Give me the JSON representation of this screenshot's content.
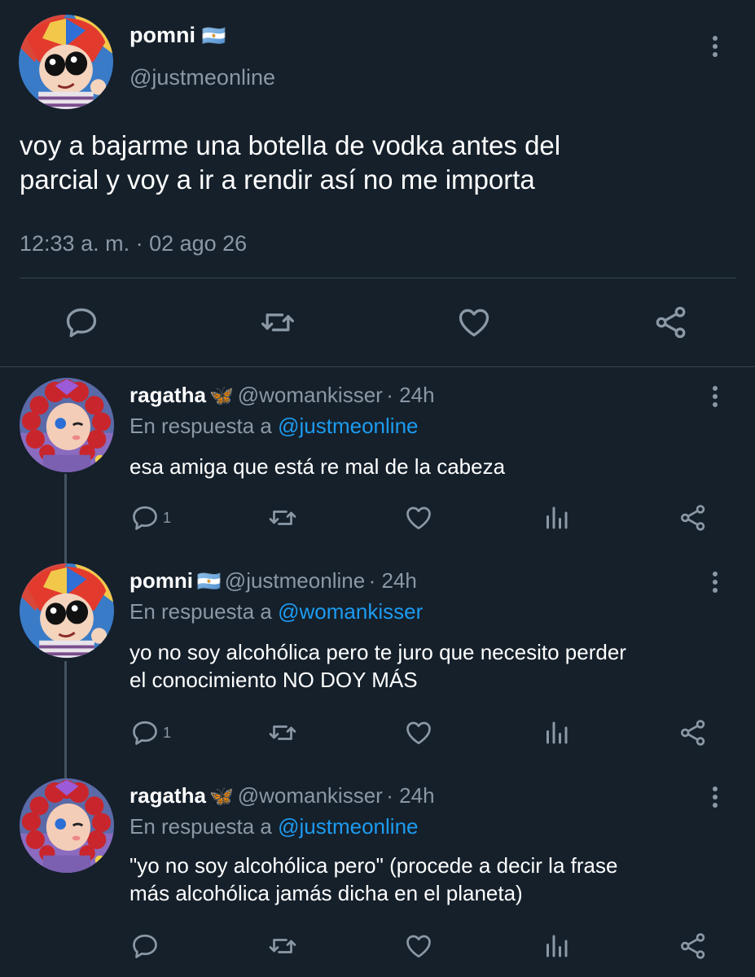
{
  "main_tweet": {
    "display_name": "pomni",
    "flag": "🇦🇷",
    "handle": "@justmeonline",
    "text_line1": "voy a bajarme una botella de vodka antes del",
    "text_line2": "parcial y voy a ir a rendir así no me importa",
    "timestamp": "12:33 a. m. · 02 ago 26"
  },
  "replies": [
    {
      "display_name": "ragatha",
      "emoji": "🦋",
      "handle": "@womankisser",
      "age": "· 24h",
      "reply_prefix": "En respuesta a",
      "reply_to": "@justmeonline",
      "text_line1": "esa amiga que está re mal de la cabeza",
      "text_line2": "",
      "reply_count": "1"
    },
    {
      "display_name": "pomni",
      "emoji": "🇦🇷",
      "handle": "@justmeonline",
      "age": "· 24h",
      "reply_prefix": "En respuesta a",
      "reply_to": "@womankisser",
      "text_line1": "yo no soy alcohólica pero te juro que necesito perder",
      "text_line2": "el conocimiento NO DOY MÁS",
      "reply_count": "1"
    },
    {
      "display_name": "ragatha",
      "emoji": "🦋",
      "handle": "@womankisser",
      "age": "· 24h",
      "reply_prefix": "En respuesta a",
      "reply_to": "@justmeonline",
      "text_line1": "\"yo no soy alcohólica pero\" (procede a decir la frase",
      "text_line2": "más alcohólica jamás dicha en el planeta)",
      "reply_count": ""
    }
  ],
  "colors": {
    "background": "#15202b",
    "text": "#ffffff",
    "muted": "#8b98a5",
    "link": "#1d9bf0",
    "divider": "#38444d"
  },
  "icons": [
    "reply-icon",
    "retweet-icon",
    "like-icon",
    "share-icon",
    "analytics-icon",
    "more-options-icon"
  ]
}
